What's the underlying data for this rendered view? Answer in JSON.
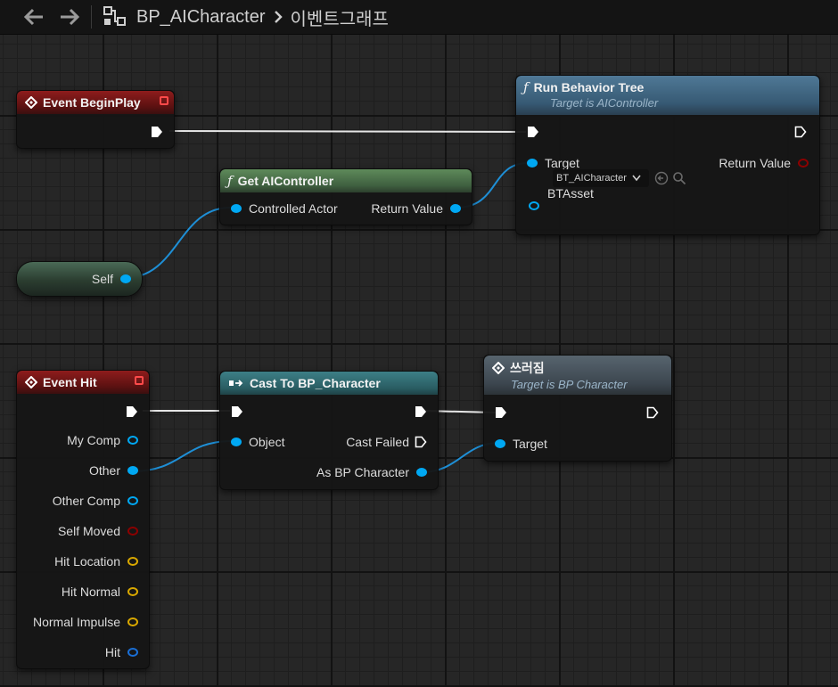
{
  "breadcrumb": {
    "blueprint": "BP_AICharacter",
    "graph": "이벤트그래프"
  },
  "icons": {
    "back": "arrow-left-icon",
    "forward": "arrow-right-icon",
    "blueprint": "blueprint-graph-icon",
    "separator": "chevron-right-icon"
  },
  "colors": {
    "object_pin": "#00a8f3",
    "struct_pin": "#d9a800",
    "bool_pin": "#8c0000",
    "exec_pin": "#ffffff"
  },
  "nodes": {
    "event_beginplay": {
      "title": "Event BeginPlay"
    },
    "run_behavior_tree": {
      "title": "Run Behavior Tree",
      "subtitle": "Target is AIController",
      "pins": {
        "target": "Target",
        "return_value": "Return Value",
        "btasset": "BTAsset"
      },
      "btasset_value": "BT_AICharacter"
    },
    "get_aicontroller": {
      "title": "Get AIController",
      "pins": {
        "controlled_actor": "Controlled Actor",
        "return_value": "Return Value"
      }
    },
    "self": {
      "label": "Self"
    },
    "event_hit": {
      "title": "Event Hit",
      "pins": {
        "my_comp": "My Comp",
        "other": "Other",
        "other_comp": "Other Comp",
        "self_moved": "Self Moved",
        "hit_location": "Hit Location",
        "hit_normal": "Hit Normal",
        "normal_impulse": "Normal Impulse",
        "hit": "Hit"
      }
    },
    "cast_to": {
      "title": "Cast To BP_Character",
      "pins": {
        "object": "Object",
        "cast_failed": "Cast Failed",
        "as_bp_character": "As BP Character"
      }
    },
    "fall_down": {
      "title": "쓰러짐",
      "subtitle": "Target is BP Character",
      "pins": {
        "target": "Target"
      }
    }
  }
}
